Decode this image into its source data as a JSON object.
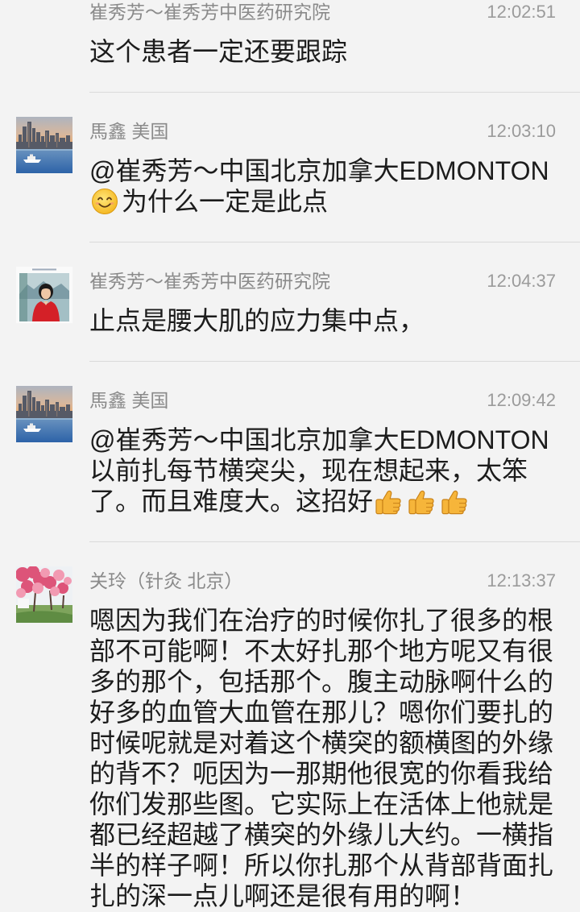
{
  "theme": {
    "background": "#f3f3f3",
    "sender_color": "#8a8a8a",
    "time_color": "#9b9b9b",
    "text_color": "#1c1c1c",
    "divider_color": "#dadada"
  },
  "messages": [
    {
      "sender": "崔秀芳～崔秀芳中医药研究院",
      "time": "12:02:51",
      "lines": [
        {
          "text": "这个患者一定还要跟踪"
        }
      ]
    },
    {
      "sender": "馬鑫 美国",
      "time": "12:03:10",
      "avatar": "city-skyline-avatar",
      "lines": [
        {
          "text": "@崔秀芳～中国北京加拿大EDMONTON"
        },
        {
          "lead_emoji": "smiling-face-emoji",
          "text": "为什么一定是此点"
        }
      ]
    },
    {
      "sender": "崔秀芳～崔秀芳中医药研究院",
      "time": "12:04:37",
      "avatar": "woman-in-red-avatar",
      "lines": [
        {
          "text": "止点是腰大肌的应力集中点，"
        }
      ]
    },
    {
      "sender": "馬鑫 美国",
      "time": "12:09:42",
      "avatar": "city-skyline-avatar",
      "lines": [
        {
          "text": "@崔秀芳～中国北京加拿大EDMONTON"
        },
        {
          "text": "以前扎每节横突尖，现在想起来，太笨"
        },
        {
          "text": "了。而且难度大。这招好",
          "trail_emoji": [
            "thumbs-up-emoji",
            "thumbs-up-emoji",
            "thumbs-up-emoji"
          ]
        }
      ]
    },
    {
      "sender": "关玲（针灸 北京）",
      "time": "12:13:37",
      "avatar": "cherry-blossom-avatar",
      "lines": [
        {
          "text": "嗯因为我们在治疗的时候你扎了很多的根"
        },
        {
          "text": "部不可能啊！不太好扎那个地方呢又有很"
        },
        {
          "text": "多的那个，包括那个。腹主动脉啊什么的"
        },
        {
          "text": "好多的血管大血管在那儿？嗯你们要扎的"
        },
        {
          "text": "时候呢就是对着这个横突的额横图的外缘"
        },
        {
          "text": "的背不？呃因为一那期他很宽的你看我给"
        },
        {
          "text": "你们发那些图。它实际上在活体上他就是"
        },
        {
          "text": "都已经超越了横突的外缘儿大约。一横指"
        },
        {
          "text": "半的样子啊！所以你扎那个从背部背面扎"
        },
        {
          "text": "扎的深一点儿啊还是很有用的啊！"
        }
      ]
    }
  ]
}
